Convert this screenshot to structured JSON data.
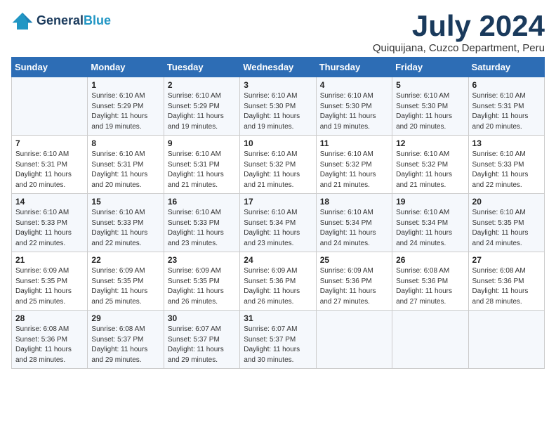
{
  "header": {
    "logo_line1": "General",
    "logo_line2": "Blue",
    "month_title": "July 2024",
    "location": "Quiquijana, Cuzco Department, Peru"
  },
  "weekdays": [
    "Sunday",
    "Monday",
    "Tuesday",
    "Wednesday",
    "Thursday",
    "Friday",
    "Saturday"
  ],
  "weeks": [
    [
      {
        "day": "",
        "sunrise": "",
        "sunset": "",
        "daylight": ""
      },
      {
        "day": "1",
        "sunrise": "Sunrise: 6:10 AM",
        "sunset": "Sunset: 5:29 PM",
        "daylight": "Daylight: 11 hours and 19 minutes."
      },
      {
        "day": "2",
        "sunrise": "Sunrise: 6:10 AM",
        "sunset": "Sunset: 5:29 PM",
        "daylight": "Daylight: 11 hours and 19 minutes."
      },
      {
        "day": "3",
        "sunrise": "Sunrise: 6:10 AM",
        "sunset": "Sunset: 5:30 PM",
        "daylight": "Daylight: 11 hours and 19 minutes."
      },
      {
        "day": "4",
        "sunrise": "Sunrise: 6:10 AM",
        "sunset": "Sunset: 5:30 PM",
        "daylight": "Daylight: 11 hours and 19 minutes."
      },
      {
        "day": "5",
        "sunrise": "Sunrise: 6:10 AM",
        "sunset": "Sunset: 5:30 PM",
        "daylight": "Daylight: 11 hours and 20 minutes."
      },
      {
        "day": "6",
        "sunrise": "Sunrise: 6:10 AM",
        "sunset": "Sunset: 5:31 PM",
        "daylight": "Daylight: 11 hours and 20 minutes."
      }
    ],
    [
      {
        "day": "7",
        "sunrise": "Sunrise: 6:10 AM",
        "sunset": "Sunset: 5:31 PM",
        "daylight": "Daylight: 11 hours and 20 minutes."
      },
      {
        "day": "8",
        "sunrise": "Sunrise: 6:10 AM",
        "sunset": "Sunset: 5:31 PM",
        "daylight": "Daylight: 11 hours and 20 minutes."
      },
      {
        "day": "9",
        "sunrise": "Sunrise: 6:10 AM",
        "sunset": "Sunset: 5:31 PM",
        "daylight": "Daylight: 11 hours and 21 minutes."
      },
      {
        "day": "10",
        "sunrise": "Sunrise: 6:10 AM",
        "sunset": "Sunset: 5:32 PM",
        "daylight": "Daylight: 11 hours and 21 minutes."
      },
      {
        "day": "11",
        "sunrise": "Sunrise: 6:10 AM",
        "sunset": "Sunset: 5:32 PM",
        "daylight": "Daylight: 11 hours and 21 minutes."
      },
      {
        "day": "12",
        "sunrise": "Sunrise: 6:10 AM",
        "sunset": "Sunset: 5:32 PM",
        "daylight": "Daylight: 11 hours and 21 minutes."
      },
      {
        "day": "13",
        "sunrise": "Sunrise: 6:10 AM",
        "sunset": "Sunset: 5:33 PM",
        "daylight": "Daylight: 11 hours and 22 minutes."
      }
    ],
    [
      {
        "day": "14",
        "sunrise": "Sunrise: 6:10 AM",
        "sunset": "Sunset: 5:33 PM",
        "daylight": "Daylight: 11 hours and 22 minutes."
      },
      {
        "day": "15",
        "sunrise": "Sunrise: 6:10 AM",
        "sunset": "Sunset: 5:33 PM",
        "daylight": "Daylight: 11 hours and 22 minutes."
      },
      {
        "day": "16",
        "sunrise": "Sunrise: 6:10 AM",
        "sunset": "Sunset: 5:33 PM",
        "daylight": "Daylight: 11 hours and 23 minutes."
      },
      {
        "day": "17",
        "sunrise": "Sunrise: 6:10 AM",
        "sunset": "Sunset: 5:34 PM",
        "daylight": "Daylight: 11 hours and 23 minutes."
      },
      {
        "day": "18",
        "sunrise": "Sunrise: 6:10 AM",
        "sunset": "Sunset: 5:34 PM",
        "daylight": "Daylight: 11 hours and 24 minutes."
      },
      {
        "day": "19",
        "sunrise": "Sunrise: 6:10 AM",
        "sunset": "Sunset: 5:34 PM",
        "daylight": "Daylight: 11 hours and 24 minutes."
      },
      {
        "day": "20",
        "sunrise": "Sunrise: 6:10 AM",
        "sunset": "Sunset: 5:35 PM",
        "daylight": "Daylight: 11 hours and 24 minutes."
      }
    ],
    [
      {
        "day": "21",
        "sunrise": "Sunrise: 6:09 AM",
        "sunset": "Sunset: 5:35 PM",
        "daylight": "Daylight: 11 hours and 25 minutes."
      },
      {
        "day": "22",
        "sunrise": "Sunrise: 6:09 AM",
        "sunset": "Sunset: 5:35 PM",
        "daylight": "Daylight: 11 hours and 25 minutes."
      },
      {
        "day": "23",
        "sunrise": "Sunrise: 6:09 AM",
        "sunset": "Sunset: 5:35 PM",
        "daylight": "Daylight: 11 hours and 26 minutes."
      },
      {
        "day": "24",
        "sunrise": "Sunrise: 6:09 AM",
        "sunset": "Sunset: 5:36 PM",
        "daylight": "Daylight: 11 hours and 26 minutes."
      },
      {
        "day": "25",
        "sunrise": "Sunrise: 6:09 AM",
        "sunset": "Sunset: 5:36 PM",
        "daylight": "Daylight: 11 hours and 27 minutes."
      },
      {
        "day": "26",
        "sunrise": "Sunrise: 6:08 AM",
        "sunset": "Sunset: 5:36 PM",
        "daylight": "Daylight: 11 hours and 27 minutes."
      },
      {
        "day": "27",
        "sunrise": "Sunrise: 6:08 AM",
        "sunset": "Sunset: 5:36 PM",
        "daylight": "Daylight: 11 hours and 28 minutes."
      }
    ],
    [
      {
        "day": "28",
        "sunrise": "Sunrise: 6:08 AM",
        "sunset": "Sunset: 5:36 PM",
        "daylight": "Daylight: 11 hours and 28 minutes."
      },
      {
        "day": "29",
        "sunrise": "Sunrise: 6:08 AM",
        "sunset": "Sunset: 5:37 PM",
        "daylight": "Daylight: 11 hours and 29 minutes."
      },
      {
        "day": "30",
        "sunrise": "Sunrise: 6:07 AM",
        "sunset": "Sunset: 5:37 PM",
        "daylight": "Daylight: 11 hours and 29 minutes."
      },
      {
        "day": "31",
        "sunrise": "Sunrise: 6:07 AM",
        "sunset": "Sunset: 5:37 PM",
        "daylight": "Daylight: 11 hours and 30 minutes."
      },
      {
        "day": "",
        "sunrise": "",
        "sunset": "",
        "daylight": ""
      },
      {
        "day": "",
        "sunrise": "",
        "sunset": "",
        "daylight": ""
      },
      {
        "day": "",
        "sunrise": "",
        "sunset": "",
        "daylight": ""
      }
    ]
  ]
}
